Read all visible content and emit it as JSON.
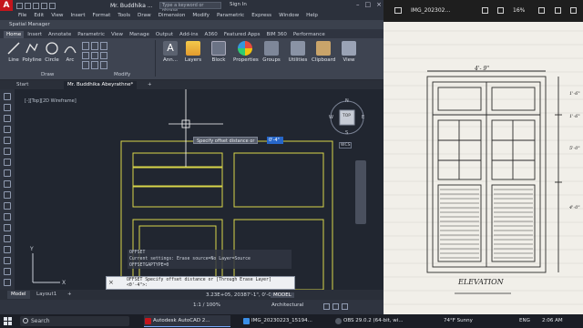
{
  "acad": {
    "title": "Mr. Buddhika ...",
    "search_placeholder": "Type a keyword or phrase",
    "signin": "Sign In",
    "menu": [
      "File",
      "Edit",
      "View",
      "Insert",
      "Format",
      "Tools",
      "Draw",
      "Dimension",
      "Modify",
      "Parametric",
      "Express",
      "Window",
      "Help"
    ],
    "spatial_manager": "Spatial Manager",
    "ribbon_tabs": [
      "Home",
      "Insert",
      "Annotate",
      "Parametric",
      "View",
      "Manage",
      "Output",
      "Add-ins",
      "A360",
      "Featured Apps",
      "BIM 360",
      "Performance"
    ],
    "ribbon_tools": {
      "line": "Line",
      "polyline": "Polyline",
      "circle": "Circle",
      "arc": "Arc",
      "annotation": "Ann...",
      "layers": "Layers",
      "block": "Block",
      "properties": "Properties",
      "groups": "Groups",
      "utilities": "Utilities",
      "clipboard": "Clipboard",
      "view": "View"
    },
    "panel_draw": "Draw",
    "panel_modify": "Modify",
    "doc_tabs": {
      "start": "Start",
      "drawing": "Mr. Buddhika Abeyrathne*"
    },
    "viewport_label": "[-][Top][2D Wireframe]",
    "viewcube": {
      "top": "TOP",
      "n": "N",
      "s": "S",
      "e": "E",
      "w": "W",
      "wcs": "WCS"
    },
    "dynamic_prompt": "Specify offset distance or",
    "dynamic_value": "0'-4\"",
    "command_history": [
      "OFFSET",
      "Current settings: Erase source=No  Layer=Source",
      "OFFSETGAPTYPE=0"
    ],
    "command_line": "OFFSET Specify offset distance or [Through Erase Layer] <0'-4\">:",
    "layout_tabs": [
      "Model",
      "Layout1"
    ],
    "status": {
      "coords": "3.23E+05, 20387'-1\", 0'-0\"",
      "model": "MODEL",
      "scale": "1:1 / 100%",
      "units": "Architectural"
    }
  },
  "photo": {
    "filename": "IMG_202302...",
    "zoom": "16%",
    "drawing_title": "ELEVATION",
    "dim_width": "4'- 9\"",
    "dim_right": [
      "1'-6\"",
      "5'-0\"",
      "4'-0\"",
      "1'-6\""
    ]
  },
  "taskbar": {
    "search": "Search",
    "apps": [
      {
        "label": "Autodesk AutoCAD 2...",
        "color": "#c4151c"
      },
      {
        "label": "IMG_20230223_15194...",
        "color": "#3a8ee6"
      },
      {
        "label": "OBS 29.0.2 (64-bit, wi...",
        "color": "#555b66"
      }
    ],
    "weather": "74°F  Sunny",
    "lang": "ENG",
    "time": "2:06 AM"
  }
}
